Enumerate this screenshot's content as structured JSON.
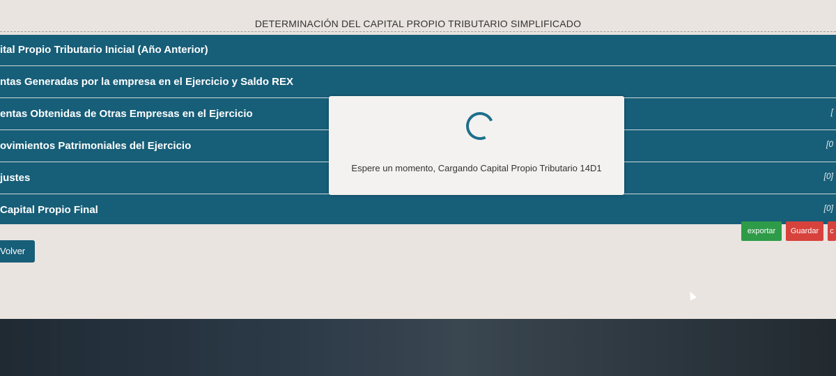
{
  "page": {
    "title": "DETERMINACIÓN DEL CAPITAL PROPIO TRIBUTARIO SIMPLIFICADO"
  },
  "rows": [
    {
      "label": "ital Propio Tributario Inicial (Año Anterior)",
      "value": ""
    },
    {
      "label": "ntas Generadas por la empresa en el Ejercicio y Saldo REX",
      "value": ""
    },
    {
      "label": "entas Obtenidas de Otras Empresas en el Ejercicio",
      "value": "["
    },
    {
      "label": "ovimientos Patrimoniales del Ejercicio",
      "value": "[0"
    },
    {
      "label": "justes",
      "value": "[0]"
    },
    {
      "label": "Capital Propio Final",
      "value": "[0]"
    }
  ],
  "buttons": {
    "export": "exportar",
    "save": "Guardar",
    "extra": "c",
    "back": "Volver"
  },
  "modal": {
    "message": "Espere un momento, Cargando Capital Propio Tributario 14D1"
  },
  "colors": {
    "panel": "#175e78",
    "export": "#2e9b48",
    "save": "#d7423c",
    "background": "#e9e4df"
  }
}
